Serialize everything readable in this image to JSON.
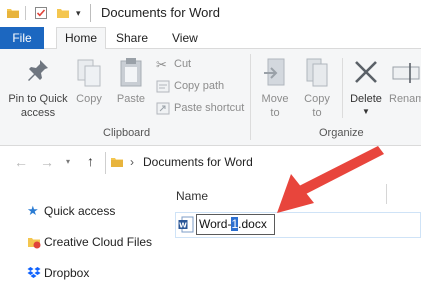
{
  "window": {
    "title": "Documents for Word",
    "quick_access_dropdown": "▾"
  },
  "tabs": {
    "file": "File",
    "home": "Home",
    "share": "Share",
    "view": "View"
  },
  "ribbon": {
    "clipboard": {
      "pin_line1": "Pin to Quick",
      "pin_line2": "access",
      "copy": "Copy",
      "paste": "Paste",
      "cut": "Cut",
      "copy_path": "Copy path",
      "paste_shortcut": "Paste shortcut",
      "group_label": "Clipboard"
    },
    "organize": {
      "move_line1": "Move",
      "move_line2": "to",
      "copy_line1": "Copy",
      "copy_line2": "to",
      "delete": "Delete",
      "rename": "Renam",
      "group_label": "Organize"
    }
  },
  "address": {
    "path": "Documents for Word",
    "separator": "›"
  },
  "file_list": {
    "column_name": "Name",
    "rename_prefix": "Word-",
    "rename_selected": "1",
    "rename_suffix": ".docx"
  },
  "nav_pane": {
    "items": [
      "Quick access",
      "Creative Cloud Files",
      "Dropbox"
    ]
  },
  "colors": {
    "file_tab": "#1c67c0",
    "arrow": "#e8453c",
    "selection": "#2c6fd0"
  }
}
